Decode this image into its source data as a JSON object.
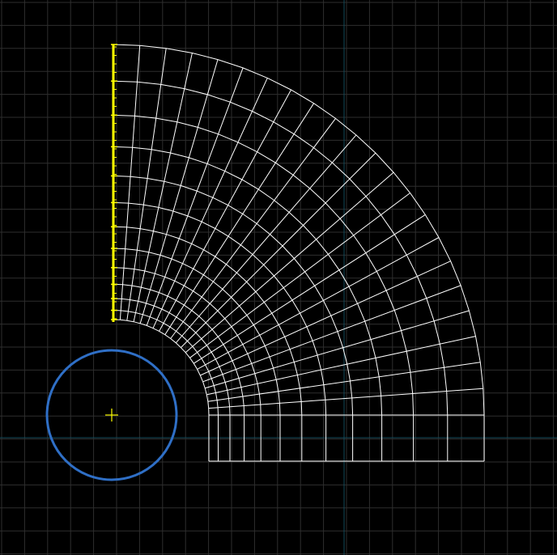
{
  "viewport": {
    "title": "",
    "background_color": "#000000",
    "grid_color": "#2e2e2e",
    "axis_color": "#124a5a",
    "mesh_color": "#ffffff",
    "highlight_edge_color": "#ffff00",
    "circle_color": "#2f6fc6",
    "center_marker_color": "#ffff00"
  },
  "mesh": {
    "radial_divisions": 12,
    "arc_divisions": 22,
    "straight_section_columns": 22
  },
  "icons": {
    "circle_center": "crosshair-plus-icon"
  }
}
